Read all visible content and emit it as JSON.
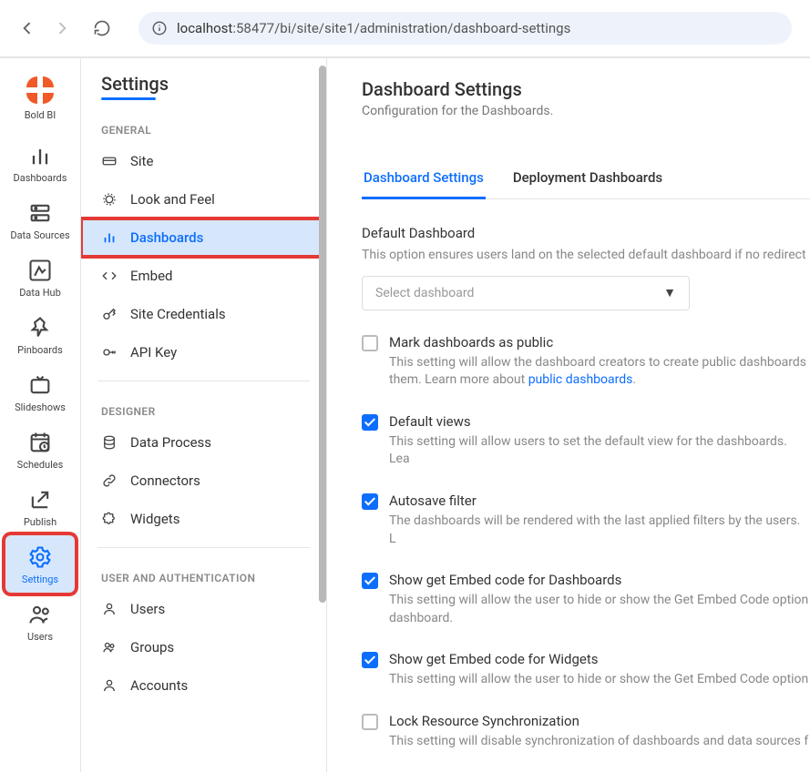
{
  "browser": {
    "url_host": "localhost",
    "url_rest": ":58477/bi/site/site1/administration/dashboard-settings"
  },
  "logo_label": "Bold BI",
  "rail": {
    "items": [
      {
        "id": "dashboards",
        "label": "Dashboards"
      },
      {
        "id": "datasources",
        "label": "Data Sources"
      },
      {
        "id": "datahub",
        "label": "Data Hub"
      },
      {
        "id": "pinboards",
        "label": "Pinboards"
      },
      {
        "id": "slideshows",
        "label": "Slideshows"
      },
      {
        "id": "schedules",
        "label": "Schedules"
      },
      {
        "id": "publish",
        "label": "Publish"
      },
      {
        "id": "settings",
        "label": "Settings"
      },
      {
        "id": "users",
        "label": "Users"
      }
    ]
  },
  "settings_panel": {
    "title": "Settings",
    "sections": {
      "general_hdr": "GENERAL",
      "designer_hdr": "DESIGNER",
      "userauth_hdr": "USER AND AUTHENTICATION"
    },
    "items": {
      "site": "Site",
      "look": "Look and Feel",
      "dashboards": "Dashboards",
      "embed": "Embed",
      "sitecred": "Site Credentials",
      "apikey": "API Key",
      "dataproc": "Data Process",
      "connectors": "Connectors",
      "widgets": "Widgets",
      "users": "Users",
      "groups": "Groups",
      "accounts": "Accounts"
    }
  },
  "content": {
    "title": "Dashboard Settings",
    "subtitle": "Configuration for the Dashboards.",
    "tabs": {
      "ds": "Dashboard Settings",
      "dd": "Deployment Dashboards"
    },
    "default_dash": {
      "title": "Default Dashboard",
      "help": "This option ensures users land on the selected default dashboard if no redirect",
      "placeholder": "Select dashboard"
    },
    "opts": {
      "public": {
        "title": "Mark dashboards as public",
        "desc_a": "This setting will allow the dashboard creators to create public dashboards ",
        "desc_b": "them. Learn more about ",
        "link": "public dashboards",
        "dot": "."
      },
      "views": {
        "title": "Default views",
        "desc": "This setting will allow users to set the default view for the dashboards. Lea"
      },
      "autosave": {
        "title": "Autosave filter",
        "desc": "The dashboards will be rendered with the last applied filters by the users. L"
      },
      "embed_dash": {
        "title": "Show get Embed code for Dashboards",
        "desc": "This setting will allow the user to hide or show the Get Embed Code option ",
        "desc2": "dashboard."
      },
      "embed_widget": {
        "title": "Show get Embed code for Widgets",
        "desc": "This setting will allow the user to hide or show the Get Embed Code option"
      },
      "lock": {
        "title": "Lock Resource Synchronization",
        "desc": "This setting will disable synchronization of dashboards and data sources f"
      }
    }
  }
}
